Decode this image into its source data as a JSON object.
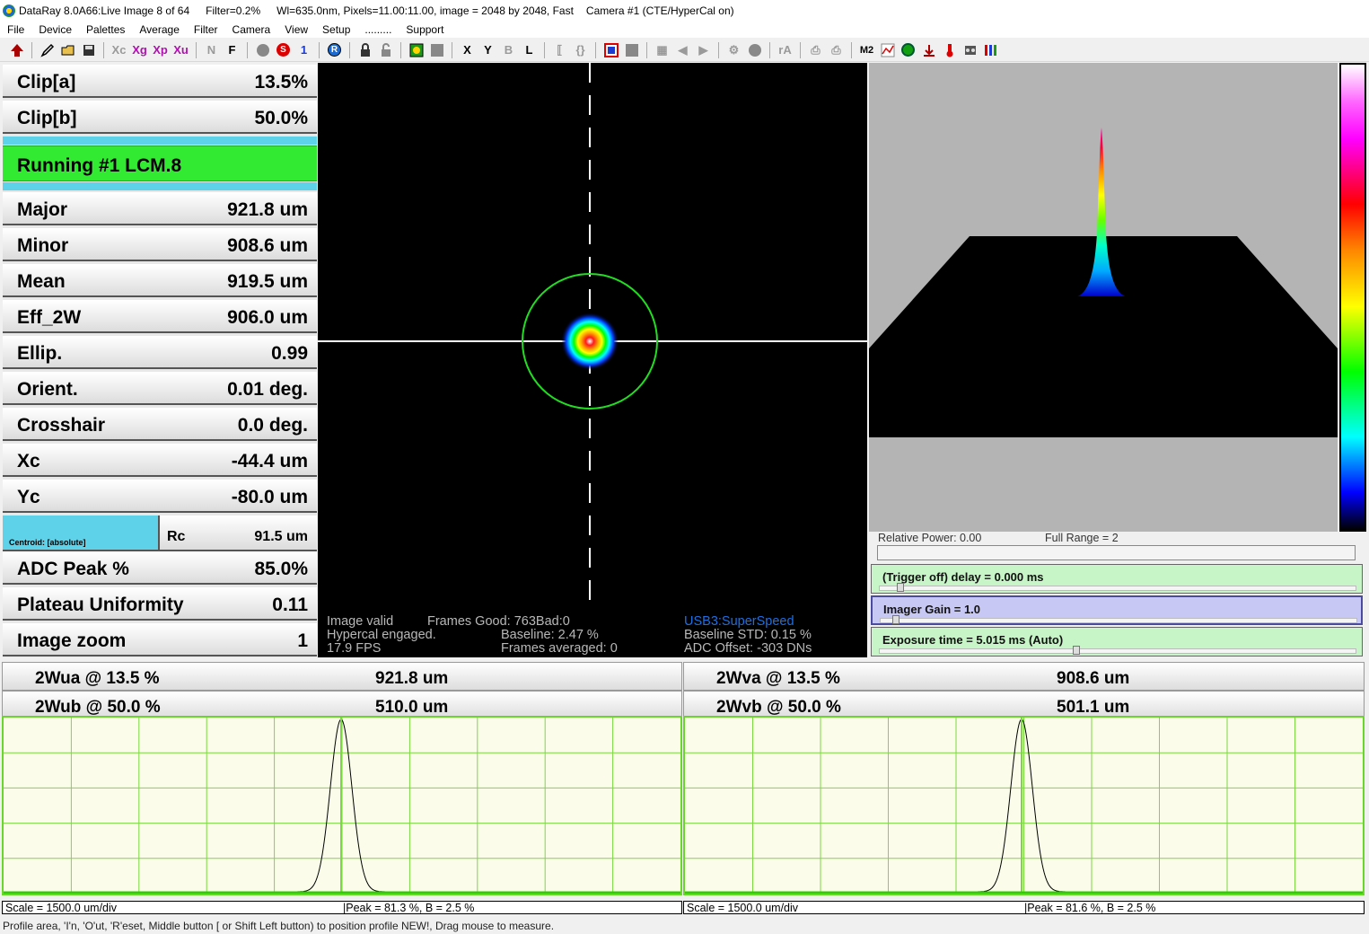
{
  "window": {
    "title": "DataRay 8.0A66:Live Image 8 of 64",
    "filter": "Filter=0.2%",
    "info": "Wl=635.0nm, Pixels=11.00:11.00, image = 2048 by 2048, Fast",
    "camera": "Camera #1  (CTE/HyperCal on)"
  },
  "menu": [
    "File",
    "Device",
    "Palettes",
    "Average",
    "Filter",
    "Camera",
    "View",
    "Setup",
    ".........",
    "Support"
  ],
  "toolbar": {
    "xc": "Xc",
    "xg": "Xg",
    "xp": "Xp",
    "xu": "Xu",
    "n": "N",
    "f": "F",
    "s": "S",
    "one": "1",
    "r": "R",
    "x": "X",
    "y": "Y",
    "b": "B",
    "l": "L",
    "ra": "rA",
    "m2": "M2"
  },
  "left_panel": {
    "clip_a": {
      "label": "Clip[a]",
      "value": "13.5%"
    },
    "clip_b": {
      "label": "Clip[b]",
      "value": "50.0%"
    },
    "running": "Running #1 LCM.8",
    "major": {
      "label": "Major",
      "value": "921.8 um"
    },
    "minor": {
      "label": "Minor",
      "value": "908.6 um"
    },
    "mean": {
      "label": "Mean",
      "value": "919.5 um"
    },
    "eff_2w": {
      "label": "Eff_2W",
      "value": "906.0 um"
    },
    "ellip": {
      "label": "Ellip.",
      "value": "0.99"
    },
    "orient": {
      "label": "Orient.",
      "value": "0.01 deg."
    },
    "crosshair": {
      "label": "Crosshair",
      "value": "0.0 deg."
    },
    "xc": {
      "label": "Xc",
      "value": "-44.4 um"
    },
    "yc": {
      "label": "Yc",
      "value": "-80.0 um"
    },
    "centroid": "Centroid: [absolute]",
    "rc": {
      "label": "Rc",
      "value": "91.5 um"
    },
    "adc_peak": {
      "label": "ADC Peak %",
      "value": "85.0%"
    },
    "plateau": {
      "label": "Plateau Uniformity",
      "value": "0.11"
    },
    "image_zoom": {
      "label": "Image zoom",
      "value": "1"
    }
  },
  "image_status": {
    "valid": "Image valid",
    "frames_good": "Frames Good: 763Bad:0",
    "usb": "USB3:SuperSpeed",
    "hypercal": "Hypercal engaged.",
    "baseline": "Baseline: 2.47 %",
    "baseline_std": "Baseline STD:  0.15 %",
    "fps": "17.9 FPS",
    "frames_averaged": "Frames averaged: 0",
    "adc_offset": "ADC Offset: -303 DNs"
  },
  "view3d": {
    "relative_power": "Relative Power: 0.00",
    "full_range": "Full Range = 2"
  },
  "controls": {
    "trigger": {
      "label": "(Trigger off) delay = 0.000 ms",
      "color": "#c8f5c8",
      "level": 0.0
    },
    "gain": {
      "label": "Imager Gain = 1.0",
      "color": "#c8c8f5",
      "level": 0.0
    },
    "exposure": {
      "label": "Exposure time = 5.015 ms (Auto)",
      "color": "#c8f5c8",
      "level": 0.4
    }
  },
  "profiles": {
    "u": {
      "w_a_label": "2Wua @ 13.5 %",
      "w_a_value": "921.8 um",
      "w_b_label": "2Wub @ 50.0 %",
      "w_b_value": "510.0 um",
      "scale": "Scale = 1500.0 um/div",
      "peak": "|Peak = 81.3 %,  B = 2.5 %"
    },
    "v": {
      "w_a_label": "2Wva @ 13.5 %",
      "w_a_value": "908.6 um",
      "w_b_label": "2Wvb @ 50.0 %",
      "w_b_value": "501.1 um",
      "scale": "Scale = 1500.0 um/div",
      "peak": "|Peak = 81.6 %,  B = 2.5 %"
    }
  },
  "status_bar": "Profile area, 'I'n,  'O'ut, 'R'eset, Middle button [ or Shift Left button) to position profile NEW!, Drag mouse to measure.",
  "colors": {
    "running": "#33ea33",
    "accent_cyan": "#5ed2e9",
    "plot_grid": "#6ad52a",
    "usb_text": "#1e6fe0"
  }
}
